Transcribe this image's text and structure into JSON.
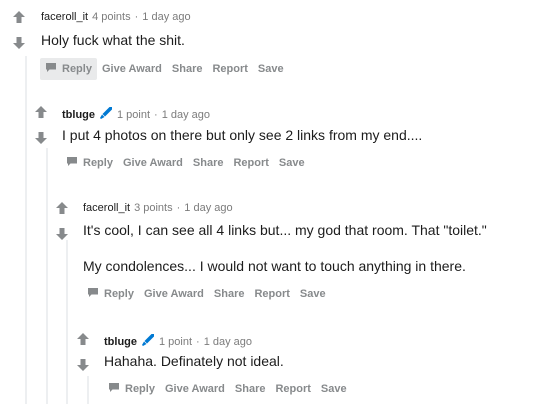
{
  "actions": {
    "reply": "Reply",
    "give_award": "Give Award",
    "share": "Share",
    "report": "Report",
    "save": "Save"
  },
  "comments": [
    {
      "author": "faceroll_it",
      "points": "4 points",
      "time": "1 day ago",
      "body": [
        "Holy fuck what the shit."
      ]
    },
    {
      "author": "tbluge",
      "points": "1 point",
      "time": "1 day ago",
      "body": [
        "I put 4 photos on there but only see 2 links from my end...."
      ]
    },
    {
      "author": "faceroll_it",
      "points": "3 points",
      "time": "1 day ago",
      "body": [
        "It's cool, I can see all 4 links but... my god that room. That \"toilet.\"",
        "My condolences... I would not want to touch anything in there."
      ]
    },
    {
      "author": "tbluge",
      "points": "1 point",
      "time": "1 day ago",
      "body": [
        "Hahaha. Definately not ideal."
      ]
    }
  ],
  "meta_separator": "·",
  "colors": {
    "vote_arrow": "#878a8c",
    "flair": "#0079d3",
    "thread_line": "#edeff1",
    "meta": "#7c7c7c"
  }
}
